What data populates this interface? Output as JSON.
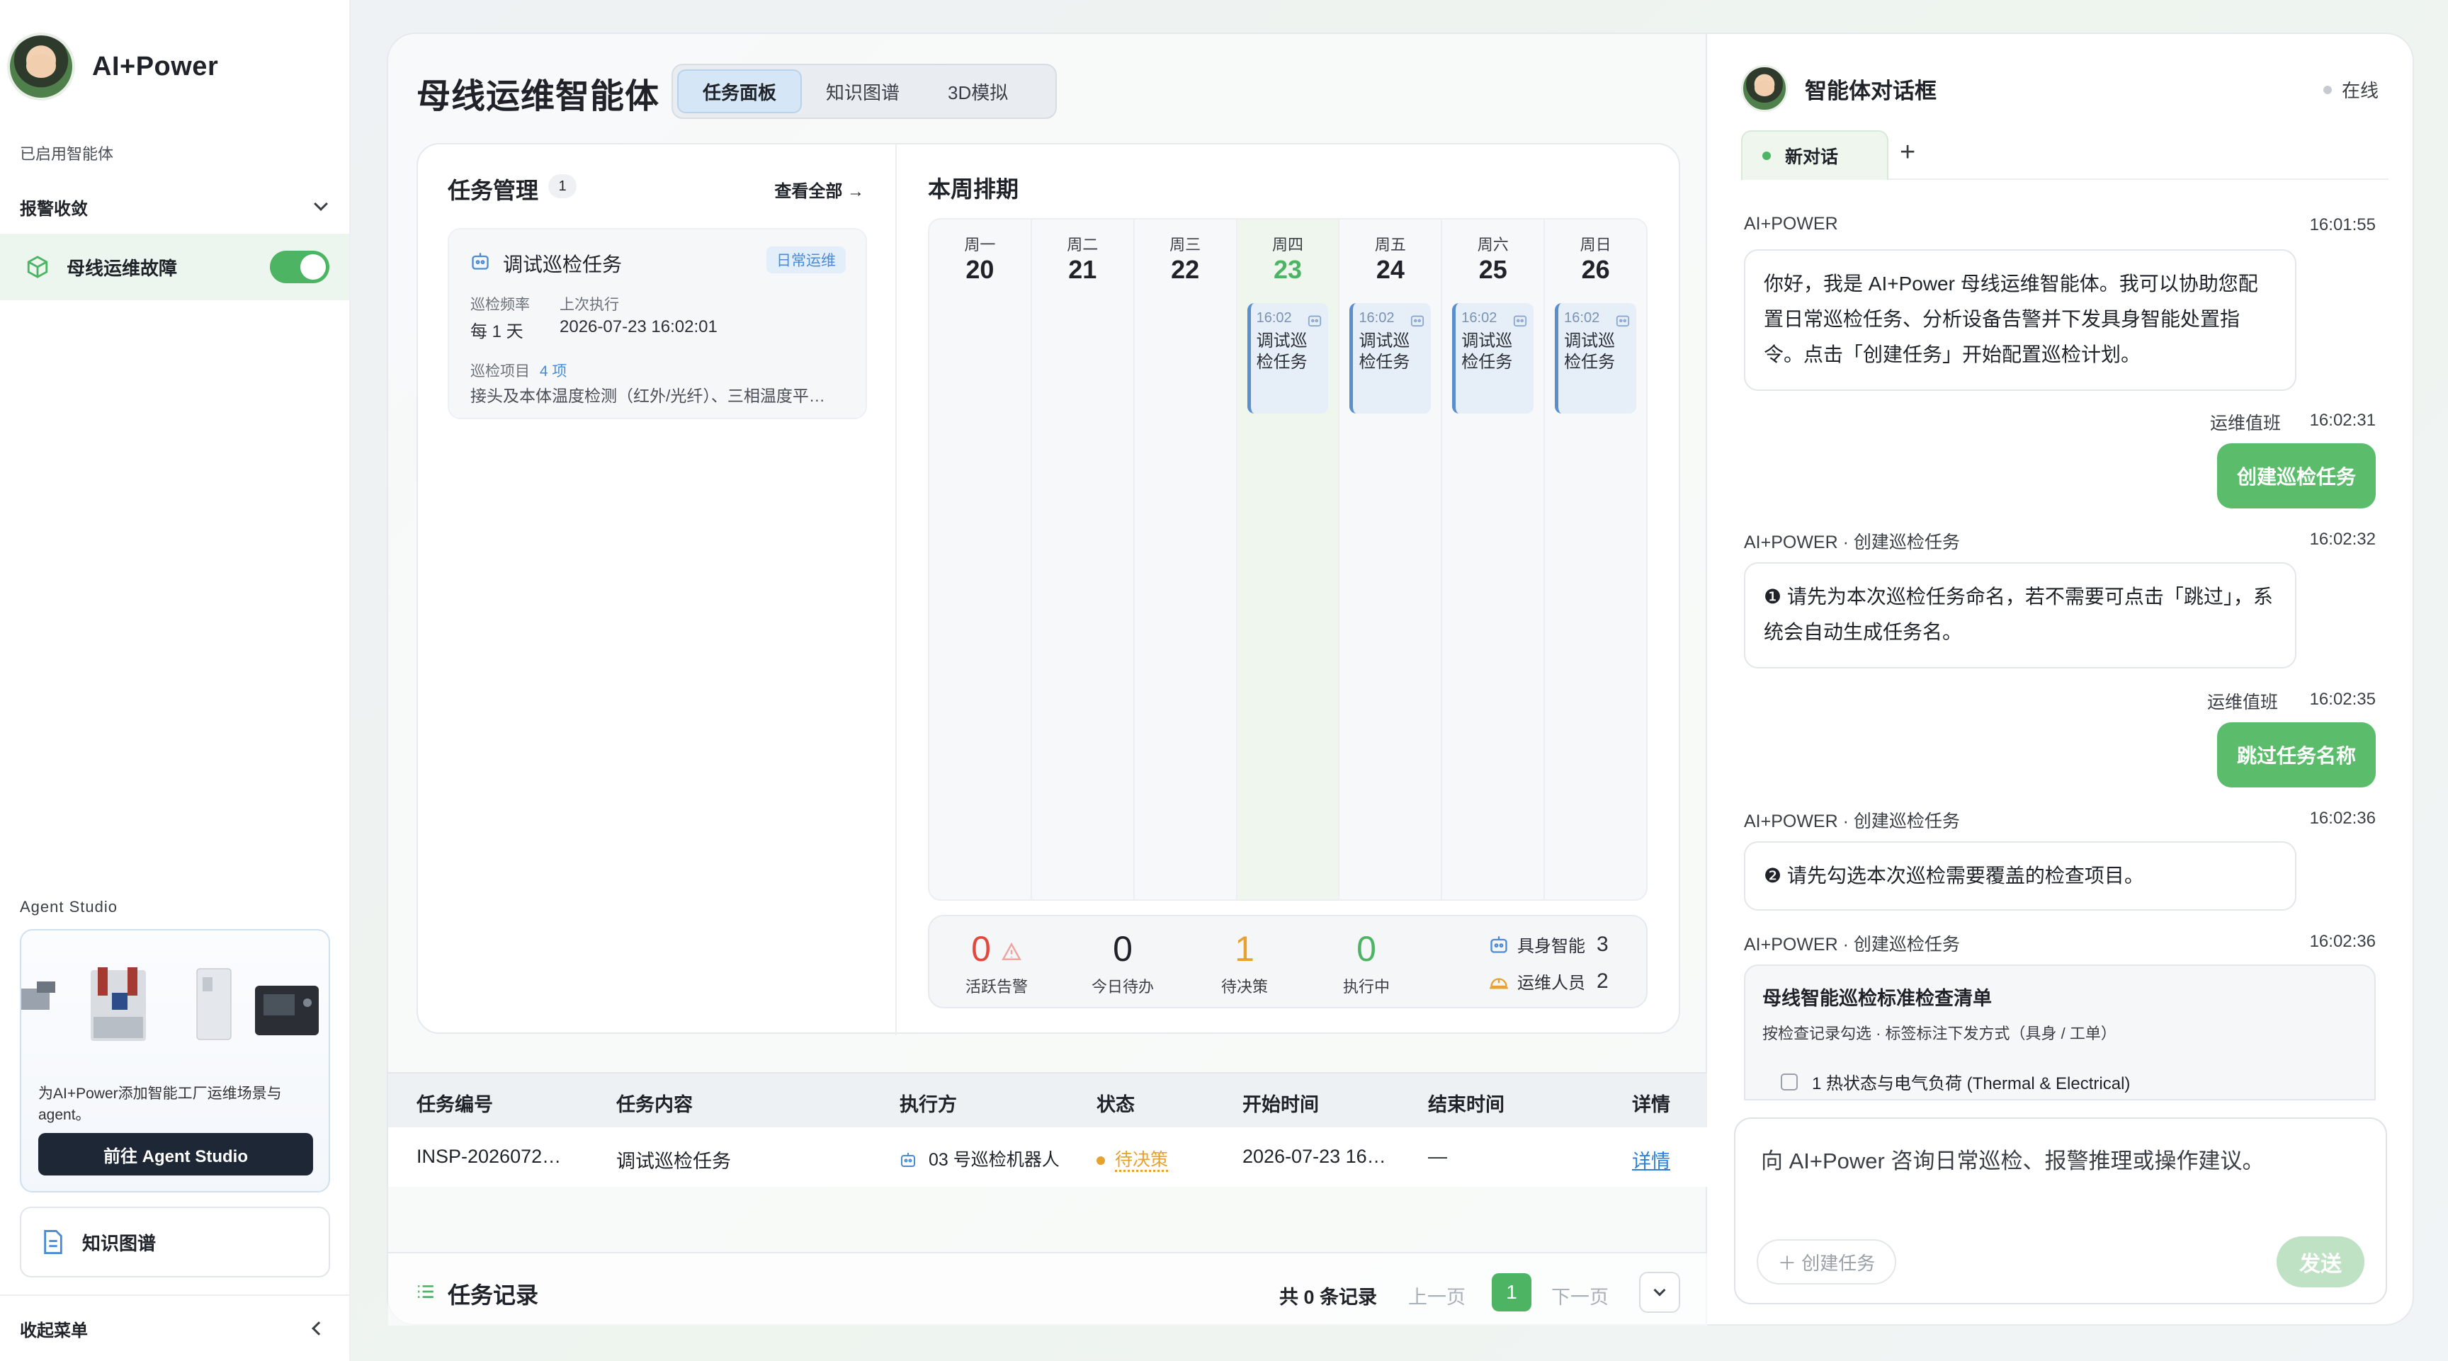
{
  "app": {
    "name": "AI+Power"
  },
  "sidebar": {
    "enabled_label": "已启用智能体",
    "group_label": "报警收敛",
    "active_item": {
      "label": "母线运维故障",
      "enabled": true
    },
    "studio": {
      "label": "Agent Studio",
      "description": "为AI+Power添加智能工厂运维场景与agent。",
      "button": "前往 Agent Studio"
    },
    "knowledge": "知识图谱",
    "collapse": "收起菜单"
  },
  "main": {
    "title": "母线运维智能体",
    "tabs": [
      {
        "label": "任务面板",
        "active": true
      },
      {
        "label": "知识图谱",
        "active": false
      },
      {
        "label": "3D模拟",
        "active": false
      }
    ],
    "tasks": {
      "title": "任务管理",
      "count": "1",
      "view_all": "查看全部 →",
      "card": {
        "title": "调试巡检任务",
        "tag": "日常运维",
        "freq_label": "巡检频率",
        "last_label": "上次执行",
        "freq_value": "每 1 天",
        "last_value": "2026-07-23 16:02:01",
        "items_label": "巡检项目",
        "items_count": "4 项",
        "items_value": "接头及本体温度检测（红外/光纤）、三相温度平…"
      }
    },
    "schedule": {
      "title": "本周排期",
      "days": [
        {
          "name": "周一",
          "num": "20"
        },
        {
          "name": "周二",
          "num": "21"
        },
        {
          "name": "周三",
          "num": "22"
        },
        {
          "name": "周四",
          "num": "23",
          "today": true,
          "event": {
            "time": "16:02",
            "name": "调试巡检任务"
          }
        },
        {
          "name": "周五",
          "num": "24",
          "event": {
            "time": "16:02",
            "name": "调试巡检任务"
          }
        },
        {
          "name": "周六",
          "num": "25",
          "event": {
            "time": "16:02",
            "name": "调试巡检任务"
          }
        },
        {
          "name": "周日",
          "num": "26",
          "event": {
            "time": "16:02",
            "name": "调试巡检任务"
          }
        }
      ]
    },
    "stats": {
      "alarm": {
        "value": "0",
        "label": "活跃告警",
        "color": "#e2483f"
      },
      "todo": {
        "value": "0",
        "label": "今日待办",
        "color": "#1f2329"
      },
      "decision": {
        "value": "1",
        "label": "待决策",
        "color": "#e7a12e"
      },
      "running": {
        "value": "0",
        "label": "执行中",
        "color": "#4cb463"
      },
      "robots": {
        "label": "具身智能",
        "value": "3"
      },
      "staff": {
        "label": "运维人员",
        "value": "2"
      }
    },
    "table": {
      "headers": [
        "任务编号",
        "任务内容",
        "执行方",
        "状态",
        "开始时间",
        "结束时间",
        "详情"
      ],
      "rows": [
        {
          "id": "INSP-2026072…",
          "content": "调试巡检任务",
          "executor": "03 号巡检机器人",
          "status": "待决策",
          "start": "2026-07-23 16…",
          "end": "—",
          "detail": "详情"
        }
      ]
    },
    "footer": {
      "title": "任务记录",
      "total": "共 0 条记录",
      "prev": "上一页",
      "page": "1",
      "next": "下一页"
    }
  },
  "chat": {
    "title": "智能体对话框",
    "status": "在线",
    "tab": "新对话",
    "add": "+",
    "messages": [
      {
        "from": "AI+POWER",
        "time": "16:01:55",
        "text": "你好，我是 AI+Power 母线运维智能体。我可以协助您配置日常巡检任务、分析设备告警并下发具身智能处置指令。点击「创建任务」开始配置巡检计划。"
      },
      {
        "from": "运维值班",
        "time": "16:02:31",
        "text": "创建巡检任务"
      },
      {
        "from": "AI+POWER · 创建巡检任务",
        "time": "16:02:32",
        "text": "❶ 请先为本次巡检任务命名，若不需要可点击「跳过」，系统会自动生成任务名。"
      },
      {
        "from": "运维值班",
        "time": "16:02:35",
        "text": "跳过任务名称"
      },
      {
        "from": "AI+POWER · 创建巡检任务",
        "time": "16:02:36",
        "text": "❷ 请先勾选本次巡检需要覆盖的检查项目。"
      },
      {
        "from": "AI+POWER · 创建巡检任务",
        "time": "16:02:36",
        "text": ""
      }
    ],
    "checklist": {
      "title": "母线智能巡检标准检查清单",
      "subtitle": "按检查记录勾选 · 标签标注下发方式（具身 / 工单）",
      "first_item": "1 热状态与电气负荷 (Thermal & Electrical)"
    },
    "input": {
      "placeholder": "向 AI+Power 咨询日常巡检、报警推理或操作建议。",
      "create": "＋ 创建任务",
      "send": "发送"
    }
  }
}
